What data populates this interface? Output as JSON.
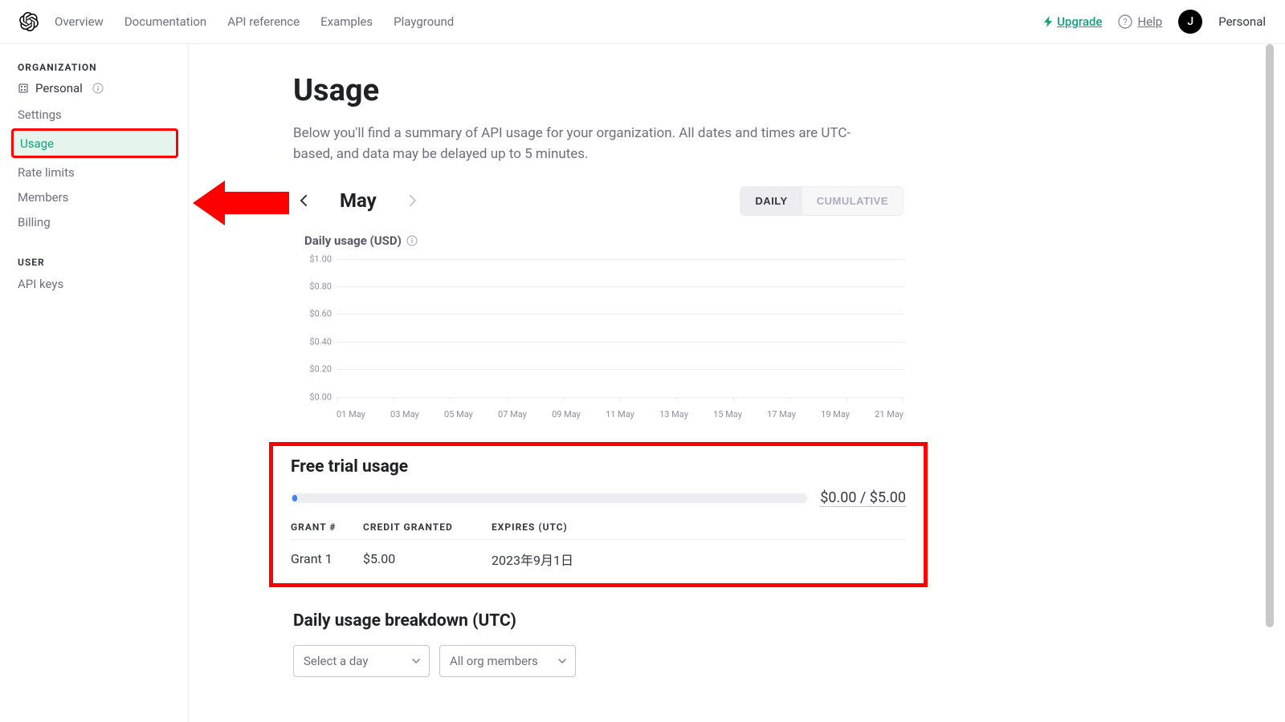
{
  "topnav": {
    "links": [
      "Overview",
      "Documentation",
      "API reference",
      "Examples",
      "Playground"
    ],
    "upgrade": "Upgrade",
    "help": "Help",
    "avatar_initial": "J",
    "account_label": "Personal"
  },
  "sidebar": {
    "org_heading": "ORGANIZATION",
    "org_name": "Personal",
    "org_items": [
      "Settings",
      "Usage",
      "Rate limits",
      "Members",
      "Billing"
    ],
    "active_item": "Usage",
    "user_heading": "USER",
    "user_items": [
      "API keys"
    ]
  },
  "page": {
    "title": "Usage",
    "description": "Below you'll find a summary of API usage for your organization. All dates and times are UTC-based, and data may be delayed up to 5 minutes.",
    "month": "May",
    "view_daily": "DAILY",
    "view_cumulative": "CUMULATIVE",
    "chart_title": "Daily usage (USD)"
  },
  "free_trial": {
    "title": "Free trial usage",
    "progress_text": "$0.00 / $5.00",
    "col_grant": "GRANT #",
    "col_credit": "CREDIT GRANTED",
    "col_expires": "EXPIRES (UTC)",
    "row": {
      "grant": "Grant 1",
      "credit": "$5.00",
      "expires": "2023年9月1日"
    }
  },
  "breakdown": {
    "title": "Daily usage breakdown (UTC)",
    "select_day": "Select a day",
    "select_members": "All org members"
  },
  "chart_data": {
    "type": "bar",
    "title": "Daily usage (USD)",
    "ylabel": "USD",
    "ylim": [
      0,
      1.0
    ],
    "yticks": [
      "$1.00",
      "$0.80",
      "$0.60",
      "$0.40",
      "$0.20",
      "$0.00"
    ],
    "categories": [
      "01 May",
      "03 May",
      "05 May",
      "07 May",
      "09 May",
      "11 May",
      "13 May",
      "15 May",
      "17 May",
      "19 May",
      "21 May"
    ],
    "values": [
      0,
      0,
      0,
      0,
      0,
      0,
      0,
      0,
      0,
      0,
      0
    ]
  }
}
